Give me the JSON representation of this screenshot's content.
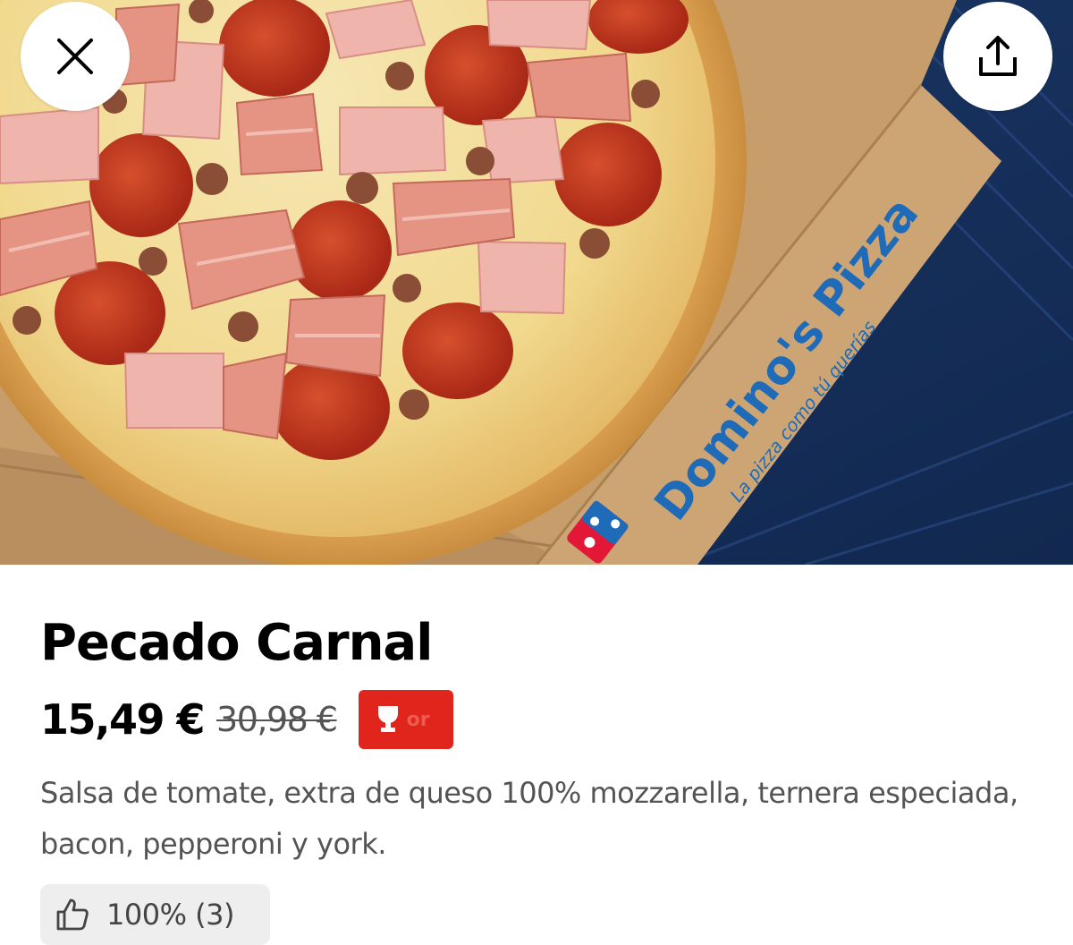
{
  "header": {
    "close_icon": "close-icon",
    "share_icon": "share-icon"
  },
  "hero": {
    "box_brand": "Domino's Pizza",
    "box_tagline": "La pizza como tú querías"
  },
  "product": {
    "name": "Pecado Carnal",
    "price": "15,49 €",
    "original_price": "30,98 €",
    "promo_badge_icon": "trophy-icon",
    "promo_badge_text": "or",
    "description": "Salsa de tomate, extra de queso 100% mozzarella, ternera especiada, bacon, pepperoni y york.",
    "rating_icon": "thumbs-up-icon",
    "rating_text": "100% (3)"
  },
  "colors": {
    "promo_red": "#e0261c",
    "text_primary": "#000000",
    "text_secondary": "#545454",
    "chip_background": "#eeeeee",
    "brand_blue": "#1f6bb8"
  }
}
